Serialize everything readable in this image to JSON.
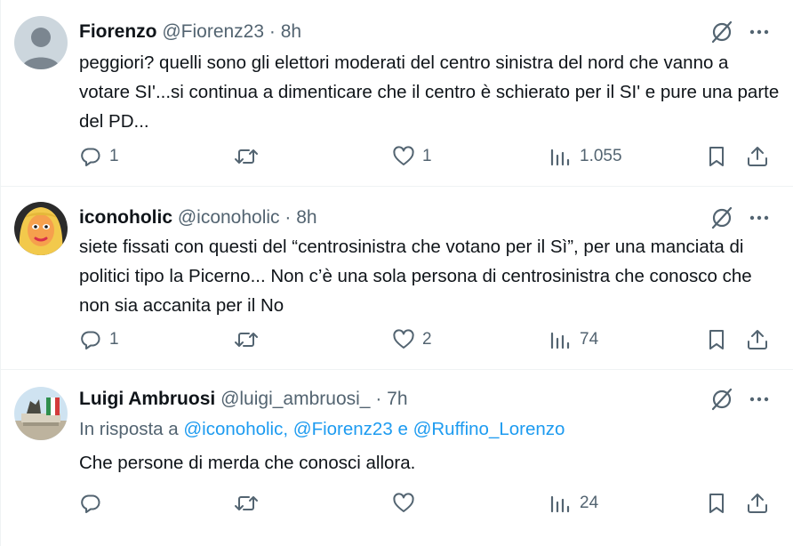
{
  "tweets": [
    {
      "name": "Fiorenzo",
      "handle": "@Fiorenz23",
      "sep": "·",
      "time": "8h",
      "text": "peggiori? quelli sono gli elettori moderati del centro sinistra del nord che vanno a votare SI'...si continua a dimenticare che il centro è schierato per il SI' e pure una parte del PD...",
      "replies": "1",
      "retweets": "",
      "likes": "1",
      "views": "1.055"
    },
    {
      "name": "iconoholic",
      "handle": "@iconoholic",
      "sep": "·",
      "time": "8h",
      "text": "siete fissati con questi del “centrosinistra che votano per il Sì”, per una manciata di politici tipo la Picerno... Non c’è una sola persona di centrosinistra che conosco che non sia accanita per il No",
      "replies": "1",
      "retweets": "",
      "likes": "2",
      "views": "74"
    },
    {
      "name": "Luigi Ambruosi",
      "handle": "@luigi_ambruosi_",
      "sep": "·",
      "time": "7h",
      "reply_prefix": "In risposta a",
      "mention_1": "@iconoholic",
      "comma": ",",
      "mention_2": "@Fiorenz23",
      "conj": "e",
      "mention_3": "@Ruffino_Lorenzo",
      "text": "Che persone di merda che conosci allora.",
      "replies": "",
      "retweets": "",
      "likes": "",
      "views": "24"
    }
  ],
  "icons": {
    "grok": "slashed-circle-icon",
    "more": "more-icon",
    "reply": "reply-icon",
    "retweet": "retweet-icon",
    "like": "like-icon",
    "views": "views-icon",
    "bookmark": "bookmark-icon",
    "share": "share-icon"
  },
  "colors": {
    "text": "#0f1419",
    "secondary": "#536471",
    "link": "#1d9bf0",
    "divider": "#eff3f4"
  }
}
